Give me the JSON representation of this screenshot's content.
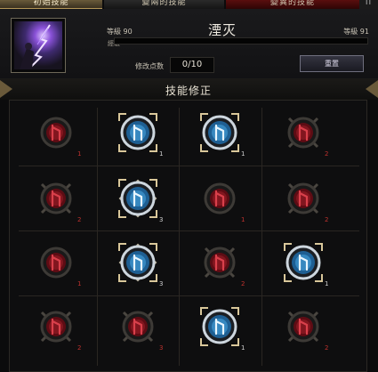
{
  "tabs": [
    {
      "label": "初始技能"
    },
    {
      "label": "變兩的技能"
    },
    {
      "label": "變異的技能"
    },
    {
      "label": "II"
    }
  ],
  "skill": {
    "name": "湮灭",
    "level_left": "等級 90",
    "level_right": "等級 91",
    "exp_label": "經驗",
    "exp_fraction": 0.0,
    "points_label": "修改点数",
    "points_value": "0/10",
    "reset_label": "重置"
  },
  "section_title": "技能修正",
  "colors": {
    "active": "#4aa9e6",
    "locked": "#b0232d",
    "gold": "#d9c79a"
  },
  "rows": [
    [
      {
        "state": "locked",
        "rank": "1"
      },
      {
        "state": "active",
        "rank": "1"
      },
      {
        "state": "active",
        "rank": "1"
      },
      {
        "state": "locked-crossed",
        "rank": "2"
      }
    ],
    [
      {
        "state": "locked-crossed",
        "rank": "2"
      },
      {
        "state": "active-diamond",
        "rank": "3"
      },
      {
        "state": "locked",
        "rank": "1"
      },
      {
        "state": "locked-crossed",
        "rank": "2"
      }
    ],
    [
      {
        "state": "locked",
        "rank": "1"
      },
      {
        "state": "active-diamond",
        "rank": "3"
      },
      {
        "state": "locked-crossed",
        "rank": "2"
      },
      {
        "state": "active",
        "rank": "1"
      }
    ],
    [
      {
        "state": "locked-crossed",
        "rank": "2"
      },
      {
        "state": "locked-crossed",
        "rank": "3"
      },
      {
        "state": "active",
        "rank": "1"
      },
      {
        "state": "locked-crossed",
        "rank": "2"
      }
    ]
  ]
}
